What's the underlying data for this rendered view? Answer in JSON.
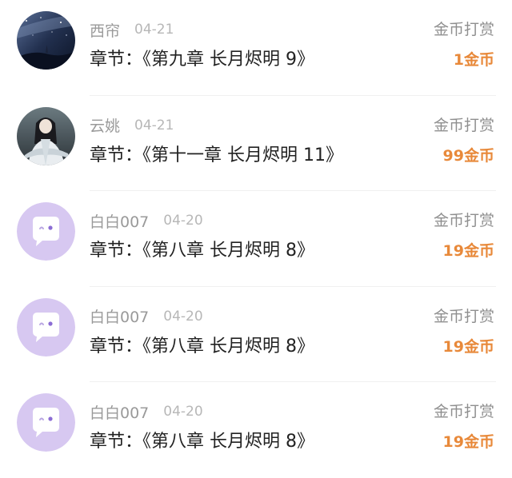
{
  "accent_color": "#e8893a",
  "rows": [
    {
      "name": "西帘",
      "date": "04-21",
      "chapter": "章节：《第九章 长月烬明 9》",
      "action": "金币打赏",
      "amount": "1金币",
      "avatar": "night-sky-avatar"
    },
    {
      "name": "云姚",
      "date": "04-21",
      "chapter": "章节：《第十一章 长月烬明 11》",
      "action": "金币打赏",
      "amount": "99金币",
      "avatar": "character-portrait-avatar"
    },
    {
      "name": "白白007",
      "date": "04-20",
      "chapter": "章节：《第八章 长月烬明 8》",
      "action": "金币打赏",
      "amount": "19金币",
      "avatar": "default-chat-bubble-avatar"
    },
    {
      "name": "白白007",
      "date": "04-20",
      "chapter": "章节：《第八章 长月烬明 8》",
      "action": "金币打赏",
      "amount": "19金币",
      "avatar": "default-chat-bubble-avatar"
    },
    {
      "name": "白白007",
      "date": "04-20",
      "chapter": "章节：《第八章 长月烬明 8》",
      "action": "金币打赏",
      "amount": "19金币",
      "avatar": "default-chat-bubble-avatar"
    }
  ]
}
